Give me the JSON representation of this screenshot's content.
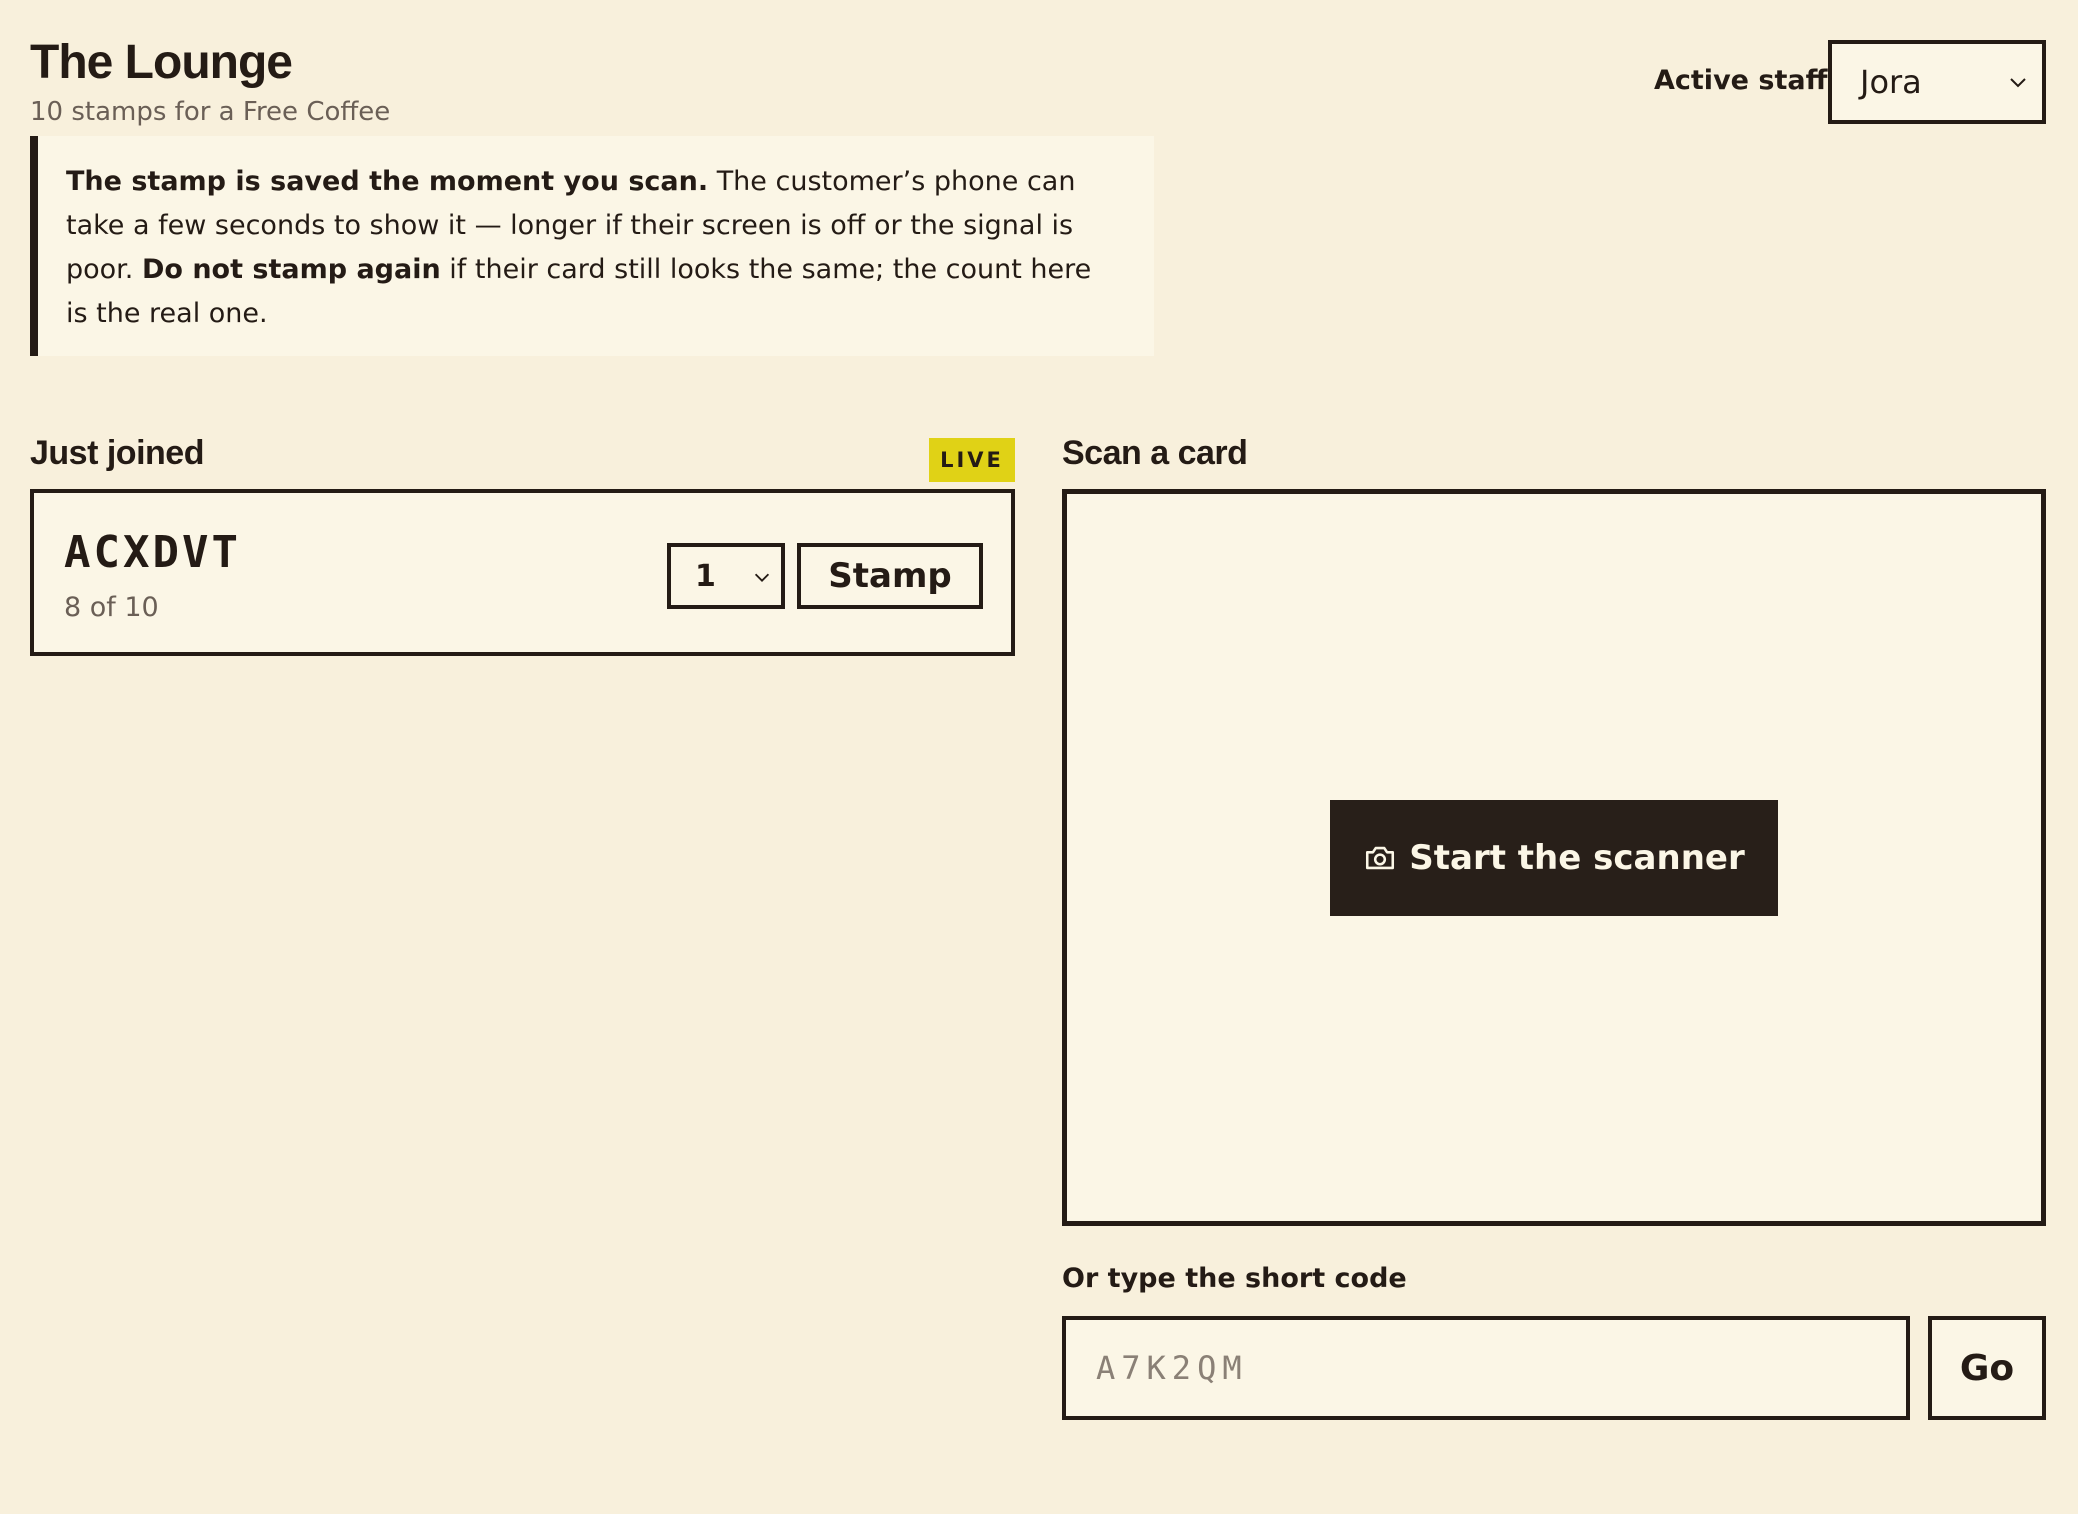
{
  "header": {
    "title": "The Lounge",
    "subtitle": "10 stamps for a Free Coffee",
    "staff_label": "Active staff",
    "staff_selected": "Jora"
  },
  "notice": {
    "part1_bold": "The stamp is saved the moment you scan.",
    "part2": " The customer’s phone can take a few seconds to show it — longer if their screen is off or the signal is poor. ",
    "part3_bold": "Do not stamp again",
    "part4": " if their card still looks the same; the count here is the real one."
  },
  "just_joined": {
    "title": "Just joined",
    "badge": "LIVE",
    "cards": [
      {
        "code": "ACXDVT",
        "progress": "8 of 10",
        "quantity": "1",
        "stamp_label": "Stamp"
      }
    ]
  },
  "scan": {
    "title": "Scan a card",
    "start_label": "Start the scanner",
    "start_icon": "camera-icon"
  },
  "short_code": {
    "label": "Or type the short code",
    "placeholder": "A7K2QM",
    "go_label": "Go"
  },
  "colors": {
    "background": "#f8f0dc",
    "panel": "#fbf6e6",
    "ink": "#241b15",
    "live_badge": "#e0d216",
    "muted_text": "#6a5f56"
  }
}
